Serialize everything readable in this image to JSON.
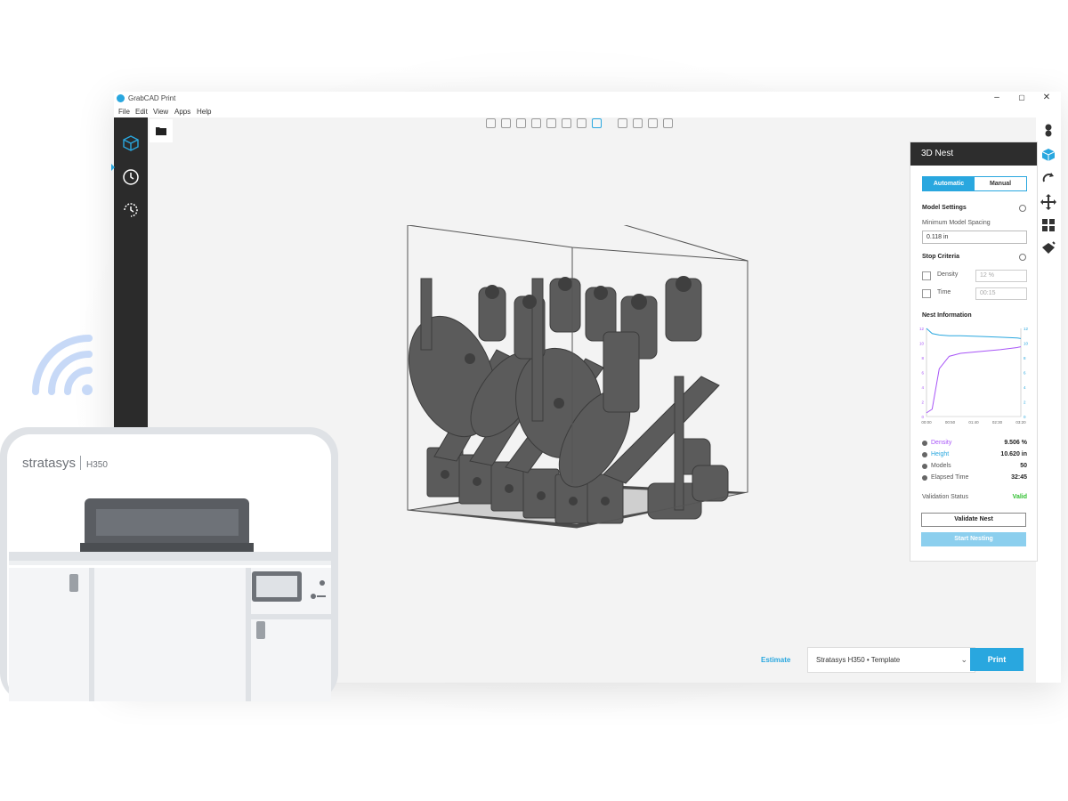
{
  "window": {
    "title": "GrabCAD Print",
    "controls": {
      "minimize": "–",
      "maximize": "▢",
      "close": "✕"
    }
  },
  "menu": [
    "File",
    "Edit",
    "View",
    "Apps",
    "Help"
  ],
  "nest_panel": {
    "title": "3D Nest",
    "mode_tabs": {
      "automatic": "Automatic",
      "manual": "Manual",
      "selected": "Automatic"
    },
    "model_settings": {
      "title": "Model Settings",
      "spacing_label": "Minimum Model Spacing",
      "spacing_value": "0.118 in"
    },
    "stop_criteria": {
      "title": "Stop Criteria",
      "density_label": "Density",
      "density_placeholder": "12 %",
      "time_label": "Time",
      "time_placeholder": "00:15"
    },
    "nest_information": {
      "title": "Nest Information",
      "chart_data": {
        "type": "line",
        "x_ticks": [
          "00:00",
          "00:50",
          "01:40",
          "02:30",
          "03:20"
        ],
        "y_left_ticks": [
          "0",
          "2",
          "4",
          "6",
          "8",
          "10",
          "12"
        ],
        "y_right_ticks": [
          "0",
          "2",
          "4",
          "6",
          "8",
          "10",
          "12"
        ],
        "series": [
          {
            "name": "Density",
            "color": "#a855f7",
            "x": [
              0,
              0.2,
              0.45,
              0.8,
              1.2,
              2.0,
              2.6,
              3.2,
              3.33
            ],
            "y": [
              0.5,
              1,
              6.5,
              8.2,
              8.6,
              8.9,
              9.1,
              9.4,
              9.5
            ]
          },
          {
            "name": "Height",
            "color": "#29a7df",
            "x": [
              0,
              0.2,
              0.45,
              0.8,
              1.2,
              2.0,
              2.6,
              3.2,
              3.33
            ],
            "y": [
              12,
              11.3,
              11.1,
              11.0,
              11.0,
              10.9,
              10.8,
              10.7,
              10.62
            ]
          }
        ]
      },
      "stats": [
        {
          "label": "Density",
          "value": "9.506 %",
          "color": "#a855f7"
        },
        {
          "label": "Height",
          "value": "10.620 in",
          "color": "#29a7df"
        },
        {
          "label": "Models",
          "value": "50",
          "color": "#444444"
        },
        {
          "label": "Elapsed Time",
          "value": "32:45",
          "color": "#444444"
        }
      ],
      "validation_label": "Validation Status",
      "validation_value": "Valid",
      "validation_color": "#2fbf2f"
    },
    "validate_button": "Validate Nest",
    "start_button": "Start Nesting"
  },
  "bottom_bar": {
    "estimate_link": "Estimate",
    "printer_select": "Stratasys H350 • Template",
    "print_button": "Print"
  },
  "printer_illustration": {
    "brand": "stratasys",
    "model": "H350"
  },
  "colors": {
    "accent": "#29a7df",
    "dark_bar": "#2b2b2b",
    "model_gray": "#5f5f5f"
  }
}
